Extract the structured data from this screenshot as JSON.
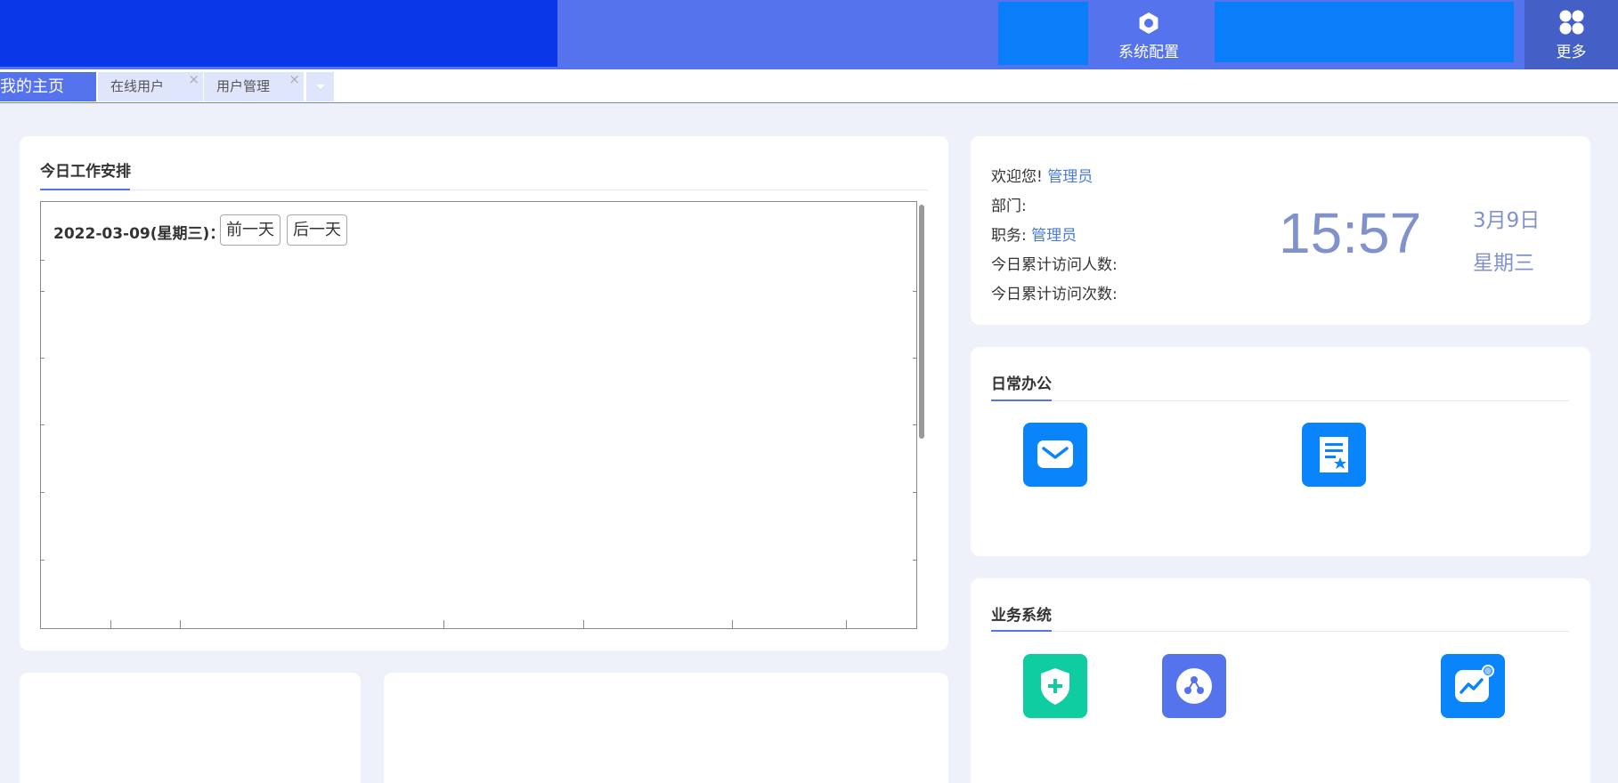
{
  "header": {
    "system_config_label": "系统配置",
    "more_label": "更多",
    "colors": {
      "bar": "#5673ee",
      "logo_area": "#0a37e8",
      "more_bg": "#4460c6",
      "placeholder": "#0a7ef9"
    }
  },
  "tabs": {
    "items": [
      {
        "label": "我的主页"
      },
      {
        "label": "在线用户",
        "close": "×"
      },
      {
        "label": "用户管理",
        "close": "×"
      }
    ]
  },
  "schedule": {
    "title": "今日工作安排",
    "date": "2022-03-09(星期三)：",
    "prev_label": "前一天",
    "next_label": "后一天"
  },
  "user_info": {
    "welcome_label": "欢迎您!",
    "welcome_name": "管理员",
    "department_label": "部门:",
    "position_label": "职务:",
    "position_value": "管理员",
    "visitors_label": "今日累计访问人数:",
    "visits_label": "今日累计访问次数:",
    "time": "15:57",
    "date": "3月9日",
    "weekday": "星期三"
  },
  "daily_office": {
    "title": "日常办公",
    "apps": [
      {
        "icon": "mail-icon",
        "color": "#0a84fa"
      },
      {
        "icon": "certificate-icon",
        "color": "#0a84fa"
      }
    ]
  },
  "business_system": {
    "title": "业务系统",
    "apps": [
      {
        "icon": "shield-plus-icon",
        "color": "#0fcda0"
      },
      {
        "icon": "molecule-icon",
        "color": "#5673ee"
      },
      {
        "icon": "trend-chart-icon",
        "color": "#0a84fa"
      }
    ]
  }
}
